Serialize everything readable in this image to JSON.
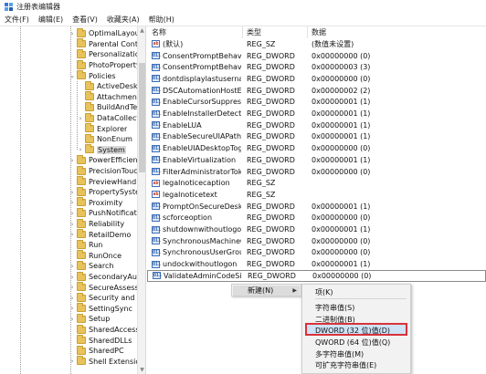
{
  "window": {
    "title": "注册表编辑器"
  },
  "menubar": [
    "文件(F)",
    "编辑(E)",
    "查看(V)",
    "收藏夹(A)",
    "帮助(H)"
  ],
  "tree": [
    {
      "label": "OptimalLayout",
      "level": 1,
      "expander": "›"
    },
    {
      "label": "Parental Contr",
      "level": 1,
      "expander": ""
    },
    {
      "label": "Personalization",
      "level": 1,
      "expander": ""
    },
    {
      "label": "PhotoPropertyH",
      "level": 1,
      "expander": ""
    },
    {
      "label": "Policies",
      "level": 1,
      "expander": "⌄"
    },
    {
      "label": "ActiveDeskto",
      "level": 2,
      "expander": ""
    },
    {
      "label": "Attachments",
      "level": 2,
      "expander": ""
    },
    {
      "label": "BuildAndTel",
      "level": 2,
      "expander": ""
    },
    {
      "label": "DataCollecti",
      "level": 2,
      "expander": "›"
    },
    {
      "label": "Explorer",
      "level": 2,
      "expander": ""
    },
    {
      "label": "NonEnum",
      "level": 2,
      "expander": ""
    },
    {
      "label": "System",
      "level": 2,
      "expander": "›",
      "selected": true
    },
    {
      "label": "PowerEfficiency",
      "level": 1,
      "expander": "›"
    },
    {
      "label": "PrecisionTouchl",
      "level": 1,
      "expander": ""
    },
    {
      "label": "PreviewHandler",
      "level": 1,
      "expander": ""
    },
    {
      "label": "PropertySystem",
      "level": 1,
      "expander": "›"
    },
    {
      "label": "Proximity",
      "level": 1,
      "expander": "›"
    },
    {
      "label": "PushNotification",
      "level": 1,
      "expander": "›"
    },
    {
      "label": "Reliability",
      "level": 1,
      "expander": "›"
    },
    {
      "label": "RetailDemo",
      "level": 1,
      "expander": "›"
    },
    {
      "label": "Run",
      "level": 1,
      "expander": ""
    },
    {
      "label": "RunOnce",
      "level": 1,
      "expander": ""
    },
    {
      "label": "Search",
      "level": 1,
      "expander": "›"
    },
    {
      "label": "SecondaryAuthl",
      "level": 1,
      "expander": "›"
    },
    {
      "label": "SecureAssessm",
      "level": 1,
      "expander": "›"
    },
    {
      "label": "Security and M",
      "level": 1,
      "expander": "›"
    },
    {
      "label": "SettingSync",
      "level": 1,
      "expander": "›"
    },
    {
      "label": "Setup",
      "level": 1,
      "expander": "›"
    },
    {
      "label": "SharedAccess",
      "level": 1,
      "expander": ""
    },
    {
      "label": "SharedDLLs",
      "level": 1,
      "expander": ""
    },
    {
      "label": "SharedPC",
      "level": 1,
      "expander": ""
    },
    {
      "label": "Shell Extensions",
      "level": 1,
      "expander": "›"
    }
  ],
  "list": {
    "headers": {
      "name": "名称",
      "type": "类型",
      "data": "数据"
    },
    "rows": [
      {
        "icon": "ab",
        "name": "(默认)",
        "type": "REG_SZ",
        "data": "(数值未设置)"
      },
      {
        "icon": "dword",
        "name": "ConsentPromptBehavior...",
        "type": "REG_DWORD",
        "data": "0x00000000 (0)"
      },
      {
        "icon": "dword",
        "name": "ConsentPromptBehavior...",
        "type": "REG_DWORD",
        "data": "0x00000003 (3)"
      },
      {
        "icon": "dword",
        "name": "dontdisplaylastusername",
        "type": "REG_DWORD",
        "data": "0x00000000 (0)"
      },
      {
        "icon": "dword",
        "name": "DSCAutomationHostEna...",
        "type": "REG_DWORD",
        "data": "0x00000002 (2)"
      },
      {
        "icon": "dword",
        "name": "EnableCursorSuppression",
        "type": "REG_DWORD",
        "data": "0x00000001 (1)"
      },
      {
        "icon": "dword",
        "name": "EnableInstallerDetection",
        "type": "REG_DWORD",
        "data": "0x00000001 (1)"
      },
      {
        "icon": "dword",
        "name": "EnableLUA",
        "type": "REG_DWORD",
        "data": "0x00000001 (1)"
      },
      {
        "icon": "dword",
        "name": "EnableSecureUIAPaths",
        "type": "REG_DWORD",
        "data": "0x00000001 (1)"
      },
      {
        "icon": "dword",
        "name": "EnableUIADesktopToggle",
        "type": "REG_DWORD",
        "data": "0x00000000 (0)"
      },
      {
        "icon": "dword",
        "name": "EnableVirtualization",
        "type": "REG_DWORD",
        "data": "0x00000001 (1)"
      },
      {
        "icon": "dword",
        "name": "FilterAdministratorToken",
        "type": "REG_DWORD",
        "data": "0x00000000 (0)"
      },
      {
        "icon": "ab",
        "name": "legalnoticecaption",
        "type": "REG_SZ",
        "data": ""
      },
      {
        "icon": "ab",
        "name": "legalnoticetext",
        "type": "REG_SZ",
        "data": ""
      },
      {
        "icon": "dword",
        "name": "PromptOnSecureDesktop",
        "type": "REG_DWORD",
        "data": "0x00000001 (1)"
      },
      {
        "icon": "dword",
        "name": "scforceoption",
        "type": "REG_DWORD",
        "data": "0x00000000 (0)"
      },
      {
        "icon": "dword",
        "name": "shutdownwithoutlogon",
        "type": "REG_DWORD",
        "data": "0x00000001 (1)"
      },
      {
        "icon": "dword",
        "name": "SynchronousMachineGr...",
        "type": "REG_DWORD",
        "data": "0x00000000 (0)"
      },
      {
        "icon": "dword",
        "name": "SynchronousUserGroup...",
        "type": "REG_DWORD",
        "data": "0x00000000 (0)"
      },
      {
        "icon": "dword",
        "name": "undockwithoutlogon",
        "type": "REG_DWORD",
        "data": "0x00000001 (1)"
      },
      {
        "icon": "dword",
        "name": "ValidateAdminCodeSign...",
        "type": "REG_DWORD",
        "data": "0x00000000 (0)"
      }
    ]
  },
  "context_menu": {
    "new_label": "新建(N)"
  },
  "submenu": {
    "items": [
      {
        "label": "项(K)"
      },
      {
        "label": "字符串值(S)"
      },
      {
        "label": "二进制值(B)"
      },
      {
        "label": "DWORD (32 位)值(D)",
        "highlighted": true
      },
      {
        "label": "QWORD (64 位)值(Q)"
      },
      {
        "label": "多字符串值(M)"
      },
      {
        "label": "可扩充字符串值(E)"
      }
    ]
  },
  "colors": {
    "highlight_border": "#d9323b",
    "folder": "#e8c25a",
    "selection": "#d9d9d9"
  }
}
